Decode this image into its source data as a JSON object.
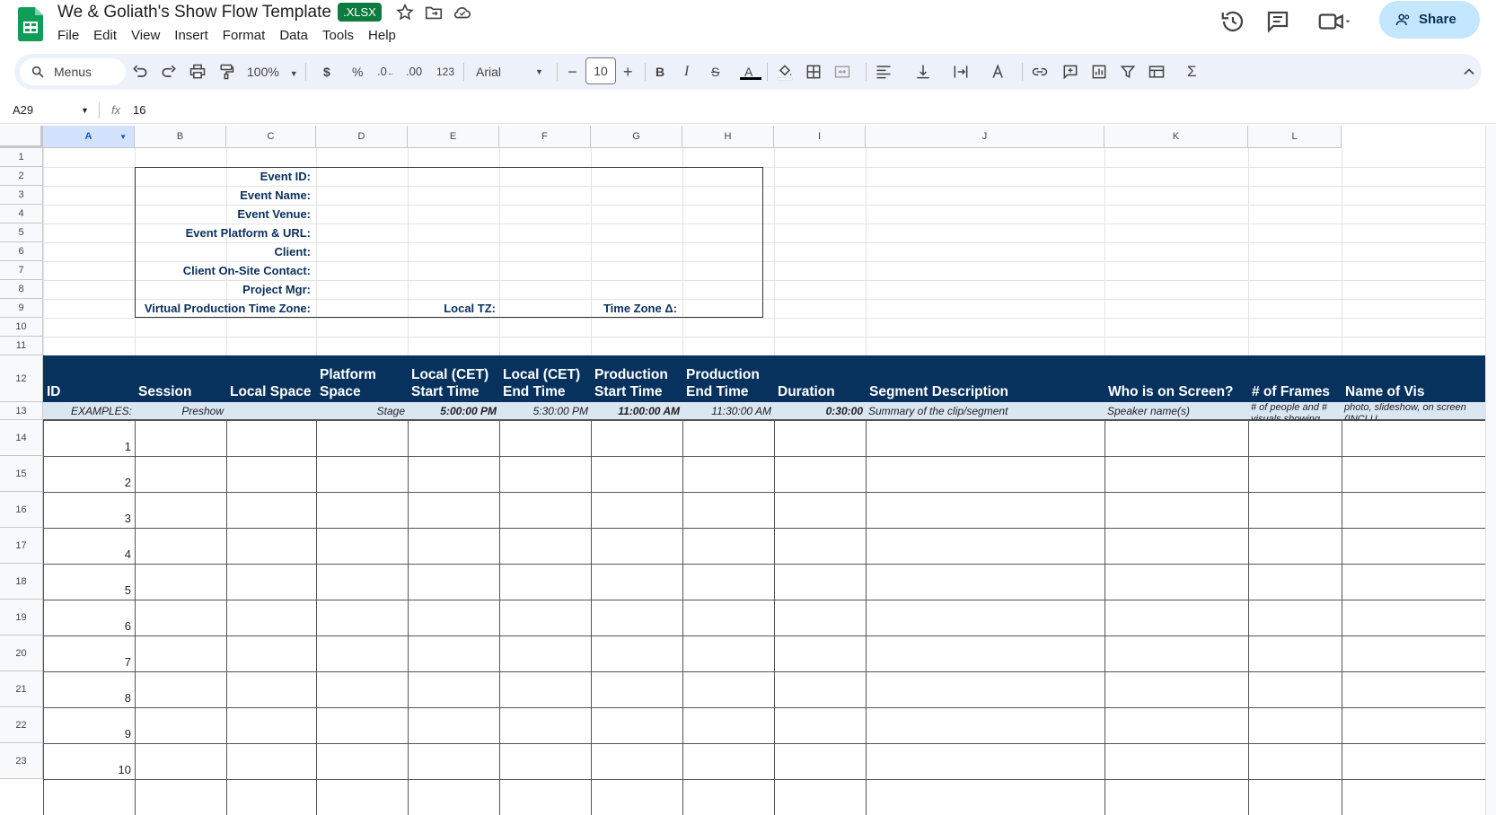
{
  "doc": {
    "title": "We & Goliath's Show Flow Template",
    "badge": ".XLSX",
    "share_label": "Share",
    "menus": [
      "File",
      "Edit",
      "View",
      "Insert",
      "Format",
      "Data",
      "Tools",
      "Help"
    ]
  },
  "toolbar": {
    "menus_label": "Menus",
    "zoom": "100%",
    "currency": "$",
    "percent": "%",
    "dec_decrease": ".0",
    "dec_increase": ".00",
    "format_123": "123",
    "font": "Arial",
    "font_size": "10"
  },
  "formula_bar": {
    "cell_ref": "A29",
    "fx": "fx",
    "value": "16"
  },
  "columns": [
    "A",
    "B",
    "C",
    "D",
    "E",
    "F",
    "G",
    "H",
    "I",
    "J",
    "K",
    "L"
  ],
  "rows": [
    "1",
    "2",
    "3",
    "4",
    "5",
    "6",
    "7",
    "8",
    "9",
    "10",
    "11",
    "12",
    "13",
    "14",
    "15",
    "16",
    "17",
    "18",
    "19",
    "20",
    "21",
    "22",
    "23"
  ],
  "event_info": {
    "event_id": "Event ID:",
    "event_name": "Event Name:",
    "event_venue": "Event Venue:",
    "event_platform": "Event Platform & URL:",
    "client": "Client:",
    "client_contact": "Client On-Site Contact:",
    "project_mgr": "Project Mgr:",
    "tz": "Virtual Production Time Zone:",
    "local_tz": "Local TZ:",
    "tz_delta": "Time Zone Δ:"
  },
  "table": {
    "headers": [
      "ID",
      "Session",
      "Local Space",
      "Platform Space",
      "Local (CET) Start Time",
      "Local (CET) End Time",
      "Production Start Time",
      "Production End Time",
      "Duration",
      "Segment Description",
      "Who is on Screen?",
      "# of Frames",
      "Name of Vis"
    ],
    "examples": [
      "EXAMPLES:",
      "Preshow",
      "",
      "Stage",
      "5:00:00 PM",
      "5:30:00 PM",
      "11:00:00 AM",
      "11:30:00 AM",
      "0:30:00",
      "Summary of the clip/segment",
      "Speaker name(s)",
      "# of people and # visuals showing",
      "photo, slideshow, on screen (INCLU"
    ],
    "ids": [
      "1",
      "2",
      "3",
      "4",
      "5",
      "6",
      "7",
      "8",
      "9",
      "10"
    ]
  },
  "colors": {
    "header_bg": "#07325e",
    "example_bg": "#dbe6f3",
    "badge": "#0f7c3f",
    "share_bg": "#c2e7ff"
  }
}
